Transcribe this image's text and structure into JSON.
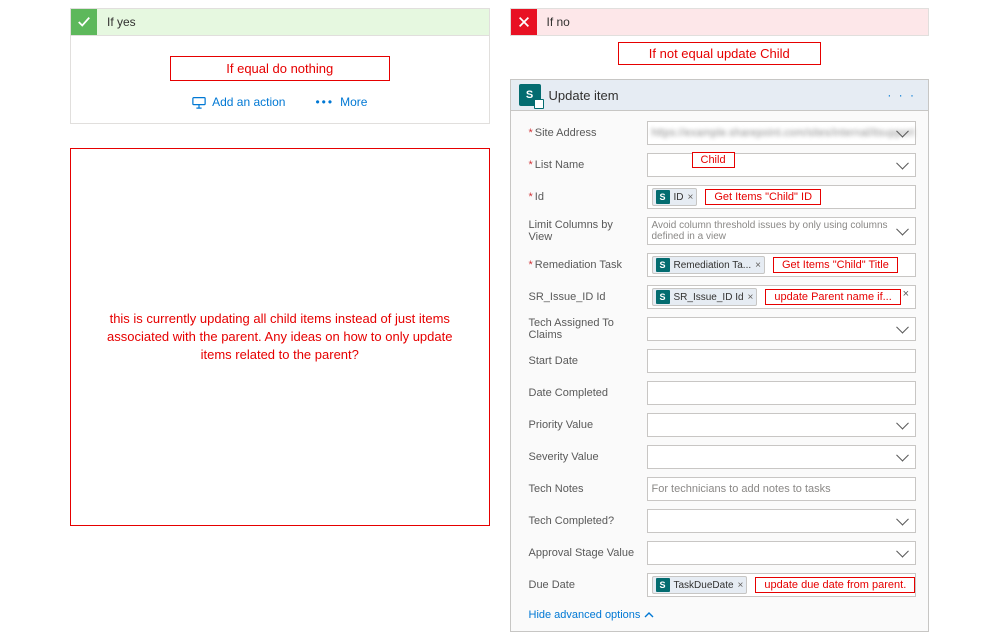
{
  "yes_branch": {
    "title": "If yes",
    "annotation": "If equal do nothing",
    "add_action": "Add an action",
    "more": "More",
    "note": "this is currently updating all child items instead of just items associated with the parent.  Any ideas on how to only update items related to the parent?"
  },
  "no_branch": {
    "title": "If no",
    "annotation": "If not equal update Child"
  },
  "update_item": {
    "title": "Update item",
    "fields": {
      "site_address": {
        "label": "Site Address",
        "value_blur": "https://example.sharepoint.com/sites/internal/itsupport"
      },
      "list_name": {
        "label": "List Name",
        "annot": "Child"
      },
      "id": {
        "label": "Id",
        "token": "ID",
        "annot": "Get Items \"Child\" ID"
      },
      "limit": {
        "label": "Limit Columns by View",
        "placeholder": "Avoid column threshold issues by only using columns defined in a view"
      },
      "remediation": {
        "label": "Remediation Task",
        "token": "Remediation Ta...",
        "annot": "Get Items \"Child\" Title"
      },
      "sr_issue": {
        "label": "SR_Issue_ID Id",
        "token": "SR_Issue_ID Id",
        "annot": "update Parent name if..."
      },
      "tech_assigned": {
        "label": "Tech Assigned To Claims"
      },
      "start_date": {
        "label": "Start Date"
      },
      "date_completed": {
        "label": "Date Completed"
      },
      "priority": {
        "label": "Priority Value"
      },
      "severity": {
        "label": "Severity Value"
      },
      "tech_notes": {
        "label": "Tech Notes",
        "placeholder": "For technicians to add notes to tasks"
      },
      "tech_completed": {
        "label": "Tech Completed?"
      },
      "approval": {
        "label": "Approval Stage Value"
      },
      "due_date": {
        "label": "Due Date",
        "token": "TaskDueDate",
        "annot": "update due date from parent."
      }
    },
    "hide_advanced": "Hide advanced options"
  }
}
